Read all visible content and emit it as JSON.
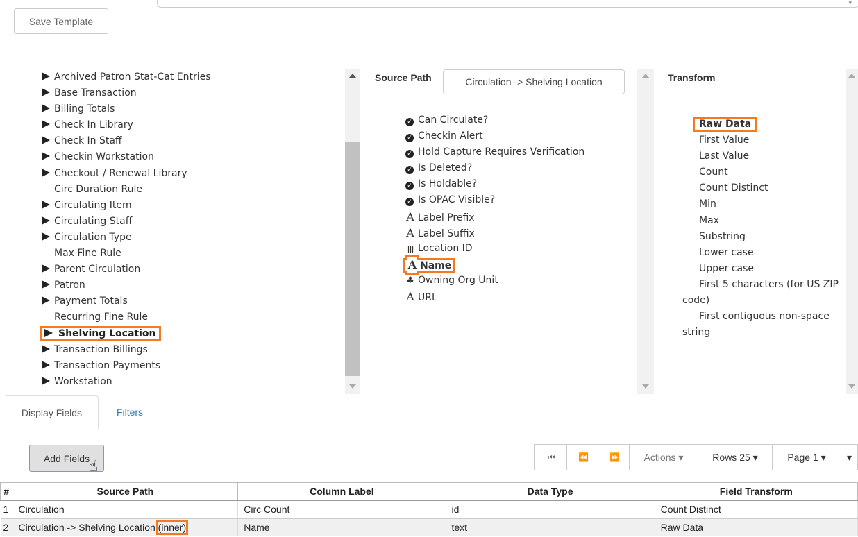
{
  "toolbar": {
    "save_label": "Save Template"
  },
  "tree": {
    "items": [
      {
        "label": "Archived Patron Stat-Cat Entries",
        "expandable": true
      },
      {
        "label": "Base Transaction",
        "expandable": true
      },
      {
        "label": "Billing Totals",
        "expandable": true
      },
      {
        "label": "Check In Library",
        "expandable": true
      },
      {
        "label": "Check In Staff",
        "expandable": true
      },
      {
        "label": "Checkin Workstation",
        "expandable": true
      },
      {
        "label": "Checkout / Renewal Library",
        "expandable": true
      },
      {
        "label": "Circ Duration Rule",
        "expandable": false
      },
      {
        "label": "Circulating Item",
        "expandable": true
      },
      {
        "label": "Circulating Staff",
        "expandable": true
      },
      {
        "label": "Circulation Type",
        "expandable": true
      },
      {
        "label": "Max Fine Rule",
        "expandable": false
      },
      {
        "label": "Parent Circulation",
        "expandable": true
      },
      {
        "label": "Patron",
        "expandable": true
      },
      {
        "label": "Payment Totals",
        "expandable": true
      },
      {
        "label": "Recurring Fine Rule",
        "expandable": false
      },
      {
        "label": "Shelving Location",
        "expandable": true,
        "selected": true
      },
      {
        "label": "Transaction Billings",
        "expandable": true
      },
      {
        "label": "Transaction Payments",
        "expandable": true
      },
      {
        "label": "Workstation",
        "expandable": true
      }
    ]
  },
  "source": {
    "header": "Source Path",
    "path_value": "Circulation -> Shelving Location",
    "fields": [
      {
        "label": "Can Circulate?",
        "icon": "check-circle-icon"
      },
      {
        "label": "Checkin Alert",
        "icon": "check-circle-icon"
      },
      {
        "label": "Hold Capture Requires Verification",
        "icon": "check-circle-icon"
      },
      {
        "label": "Is Deleted?",
        "icon": "check-circle-icon"
      },
      {
        "label": "Is Holdable?",
        "icon": "check-circle-icon"
      },
      {
        "label": "Is OPAC Visible?",
        "icon": "check-circle-icon"
      },
      {
        "label": "Label Prefix",
        "icon": "text-icon"
      },
      {
        "label": "Label Suffix",
        "icon": "text-icon"
      },
      {
        "label": "Location ID",
        "icon": "barcode-icon"
      },
      {
        "label": "Name",
        "icon": "text-icon",
        "selected": true
      },
      {
        "label": "Owning Org Unit",
        "icon": "tree-icon"
      },
      {
        "label": "URL",
        "icon": "text-icon"
      }
    ]
  },
  "transform": {
    "header": "Transform",
    "items": [
      {
        "label": "Raw Data",
        "selected": true
      },
      {
        "label": "First Value"
      },
      {
        "label": "Last Value"
      },
      {
        "label": "Count"
      },
      {
        "label": "Count Distinct"
      },
      {
        "label": "Min"
      },
      {
        "label": "Max"
      },
      {
        "label": "Substring"
      },
      {
        "label": "Lower case"
      },
      {
        "label": "Upper case"
      },
      {
        "label": "First 5 characters (for US ZIP code)",
        "wrap": true
      },
      {
        "label": "First contiguous non-space string",
        "wrap": true
      }
    ]
  },
  "tabs": [
    {
      "label": "Display Fields",
      "active": true
    },
    {
      "label": "Filters",
      "active": false
    }
  ],
  "actions": {
    "add_fields_label": "Add Fields",
    "first_page_icon": "⏮",
    "prev_page_icon": "⏪",
    "next_page_icon": "⏩",
    "actions_label": "Actions ▾",
    "rows_label": "Rows 25 ▾",
    "page_label": "Page 1 ▾",
    "more_label": "▾"
  },
  "grid": {
    "columns": [
      "#",
      "Source Path",
      "Column Label",
      "Data Type",
      "Field Transform"
    ],
    "rows": [
      {
        "num": "1",
        "source_path": "Circulation",
        "join": "",
        "column_label": "Circ Count",
        "data_type": "id",
        "transform": "Count Distinct"
      },
      {
        "num": "2",
        "source_path": "Circulation -> Shelving Location",
        "join": "(inner)",
        "column_label": "Name",
        "data_type": "text",
        "transform": "Raw Data"
      }
    ]
  },
  "colors": {
    "highlight": "#f47920",
    "link": "#337ab7"
  }
}
